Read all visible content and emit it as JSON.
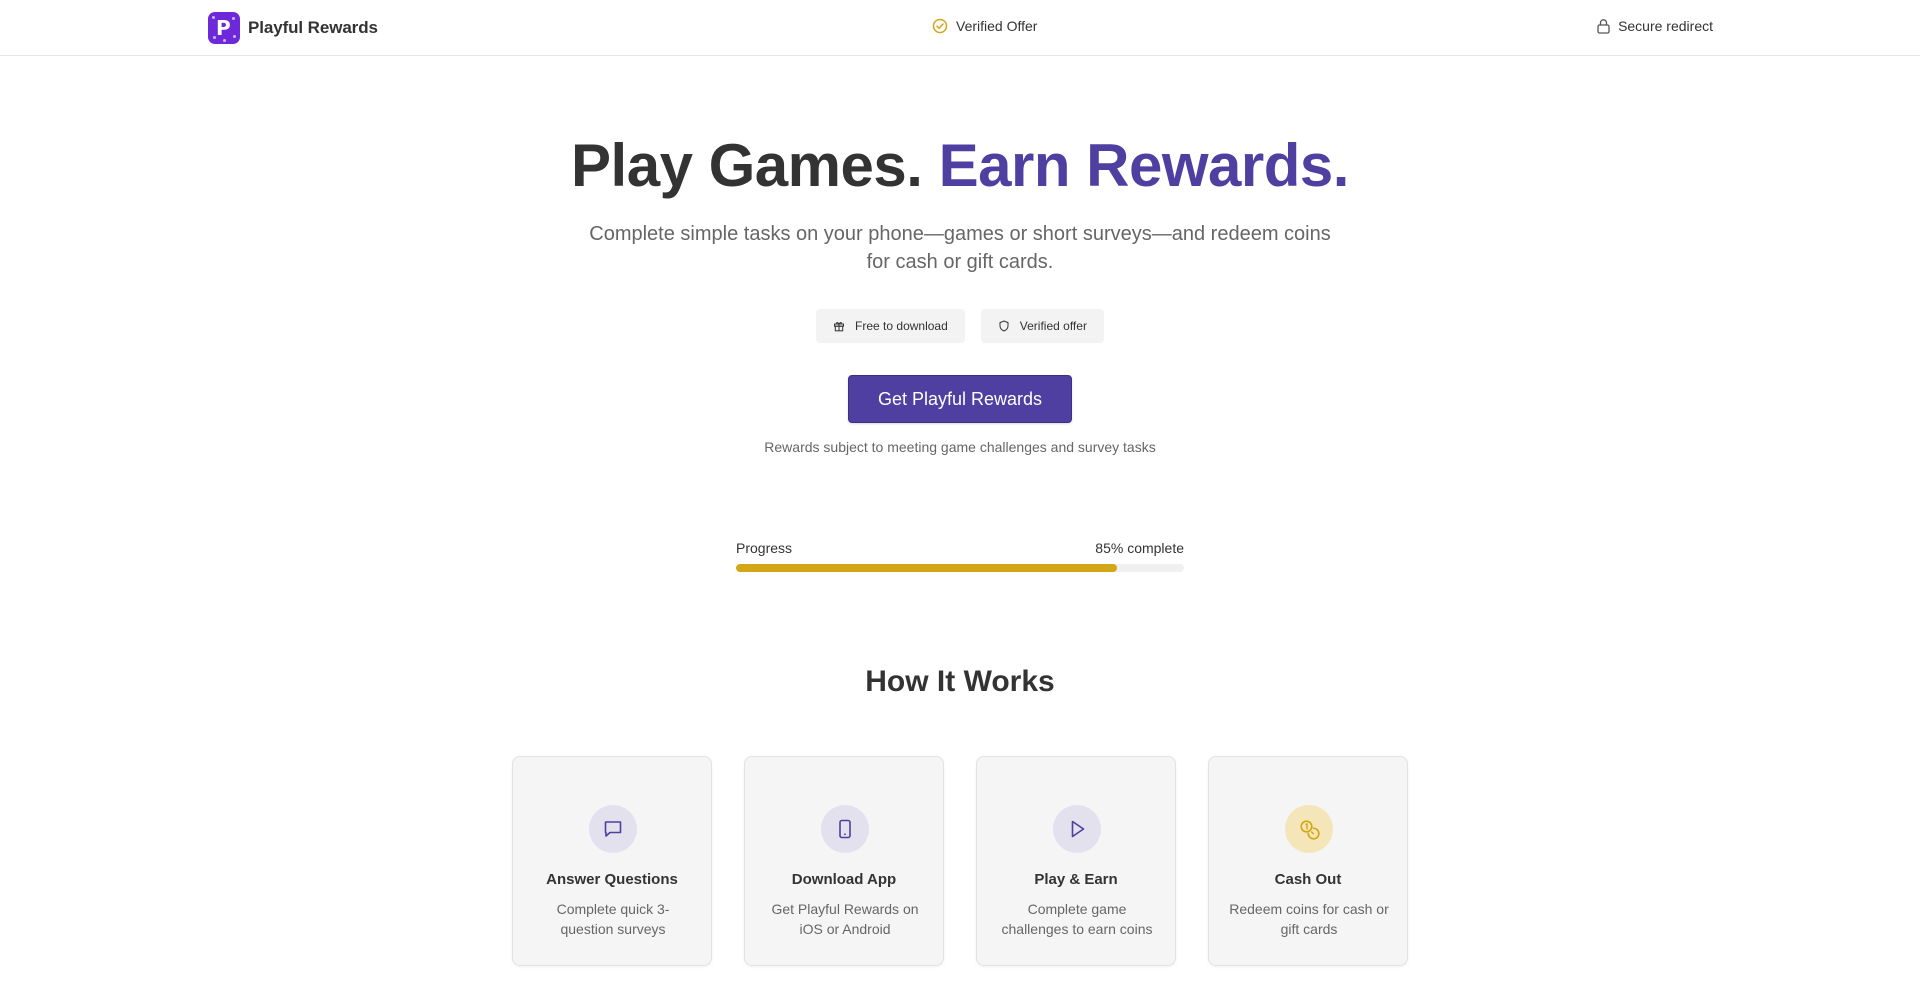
{
  "header": {
    "brand_name": "Playful Rewards",
    "logo_letter": "P",
    "verified_label": "Verified Offer",
    "secure_label": "Secure redirect"
  },
  "hero": {
    "title_part1": "Play Games.",
    "title_part2": "Earn Rewards.",
    "subtitle": "Complete simple tasks on your phone—games or short surveys—and redeem coins for cash or gift cards.",
    "badges": [
      {
        "label": "Free to download",
        "icon": "gift-icon"
      },
      {
        "label": "Verified offer",
        "icon": "shield-icon"
      }
    ],
    "cta_label": "Get Playful Rewards",
    "disclaimer": "Rewards subject to meeting game challenges and survey tasks"
  },
  "progress": {
    "label": "Progress",
    "status": "85% complete",
    "value": 0.85
  },
  "how_it_works": {
    "title": "How It Works",
    "cards": [
      {
        "icon": "chat-bubble-icon",
        "title": "Answer Questions",
        "desc": "Complete quick 3-question surveys"
      },
      {
        "icon": "phone-icon",
        "title": "Download App",
        "desc": "Get Playful Rewards on iOS or Android"
      },
      {
        "icon": "play-icon",
        "title": "Play & Earn",
        "desc": "Complete game challenges to earn coins"
      },
      {
        "icon": "coins-icon",
        "title": "Cash Out",
        "desc": "Redeem coins for cash or gift cards"
      }
    ]
  },
  "colors": {
    "accent": "#4f3fa0",
    "logo_bg": "#6d28d9",
    "gold": "#d4a515",
    "text": "#333333",
    "muted": "#666666"
  }
}
